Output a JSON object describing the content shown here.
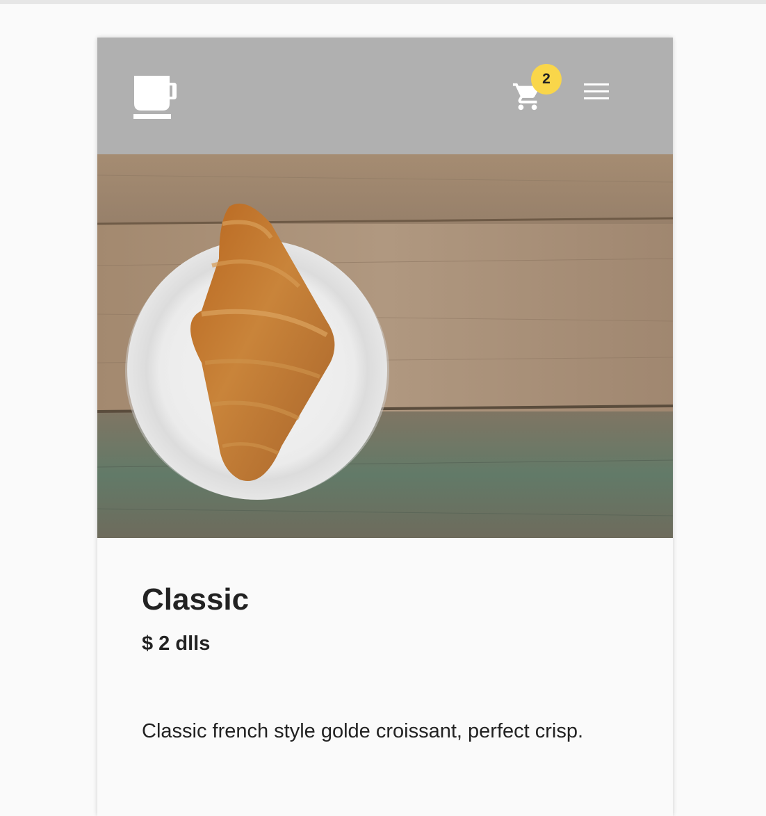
{
  "header": {
    "logo_icon": "coffee-cup-icon",
    "cart_icon": "shopping-cart-icon",
    "cart_count": "2",
    "menu_icon": "hamburger-menu-icon"
  },
  "product": {
    "name": "Classic",
    "price": "$ 2 dlls",
    "description": "Classic french style golde croissant, perfect crisp."
  },
  "colors": {
    "header_bg": "#b0b0b0",
    "badge": "#f9d64a",
    "text": "#222222",
    "page_bg": "#fafafa"
  }
}
